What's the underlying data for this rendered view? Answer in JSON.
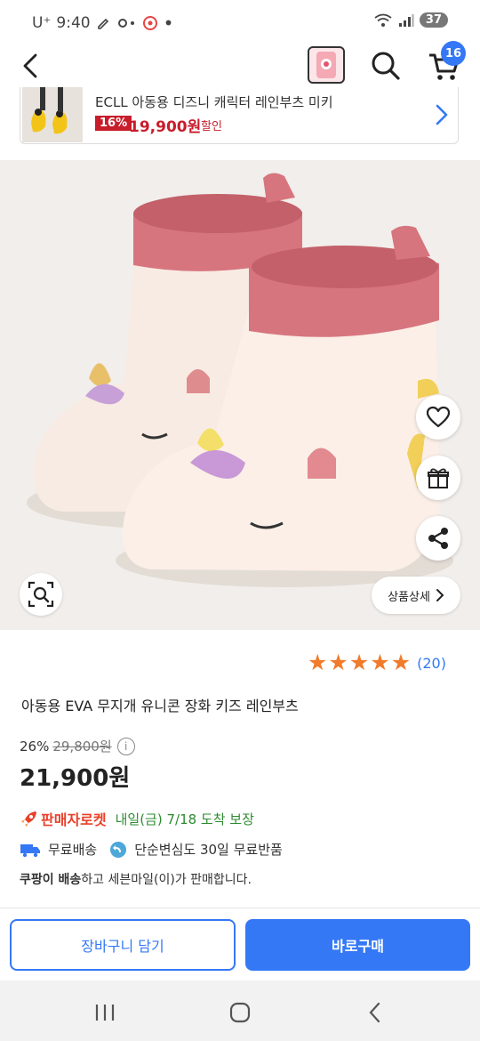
{
  "status_bar": {
    "carrier": "U⁺",
    "time": "9:40",
    "battery": "37"
  },
  "nav": {
    "cart_count": "16"
  },
  "banner": {
    "title": "ECLL 아동용 디즈니 캐릭터 레인부츠 미키",
    "discount": "16%",
    "price": "19,900원",
    "sale_label": "할인"
  },
  "hero": {
    "detail_label": "상품상세"
  },
  "rating": {
    "stars": 5,
    "count": "(20)"
  },
  "product": {
    "title": "아동용 EVA 무지개 유니콘 장화 키즈 레인부츠",
    "discount_rate": "26%",
    "original_price": "29,800원",
    "sale_price": "21,900원",
    "info_icon_glyph": "i"
  },
  "delivery": {
    "rocket_label": "판매자로켓",
    "date": "내일(금) 7/18 도착 보장",
    "free_shipping": "무료배송",
    "free_return": "단순변심도 30일 무료반품",
    "seller_prefix": "쿠팡이 배송",
    "seller_suffix": "하고 세븐마일(이)가 판매합니다."
  },
  "actions": {
    "cart_button": "장바구니 담기",
    "buy_button": "바로구매"
  },
  "colors": {
    "accent": "#3478f6",
    "price_red": "#c81d2b",
    "star": "#f27b2b",
    "rocket": "#e8402a",
    "delivery_green": "#2e8b30"
  },
  "icons": [
    "back-arrow-icon",
    "search-icon",
    "cart-icon",
    "heart-icon",
    "gift-icon",
    "share-icon",
    "zoom-icon",
    "chevron-right-icon",
    "truck-icon",
    "return-icon",
    "recent-apps-icon",
    "home-icon",
    "back-icon"
  ]
}
